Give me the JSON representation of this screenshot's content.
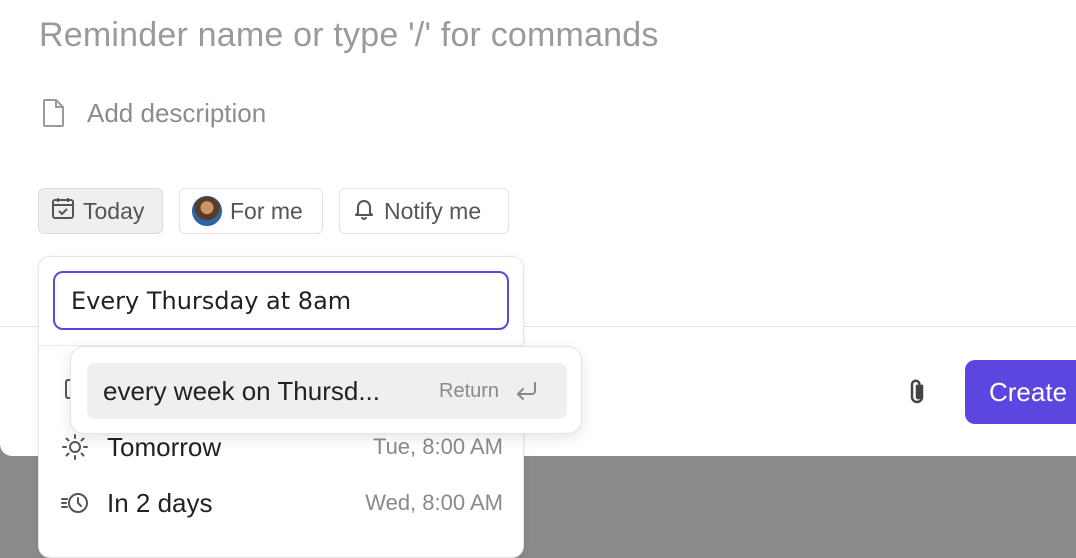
{
  "reminder": {
    "name_placeholder": "Reminder name or type '/' for commands",
    "description_label": "Add description"
  },
  "chips": {
    "date": "Today",
    "assignee": "For me",
    "notify": "Notify me"
  },
  "footer": {
    "create_label": "Create"
  },
  "date_picker": {
    "input_value": "Every Thursday at 8am",
    "suggestion": {
      "label": "every week on Thursd...",
      "hint": "Return"
    },
    "options": [
      {
        "label": "Tomorrow",
        "time": "Tue, 8:00 AM",
        "icon": "sun-icon"
      },
      {
        "label": "In 2 days",
        "time": "Wed, 8:00 AM",
        "icon": "clock-forward-icon"
      }
    ]
  },
  "colors": {
    "accent": "#5b47e0",
    "backdrop": "#8a8a8a"
  }
}
